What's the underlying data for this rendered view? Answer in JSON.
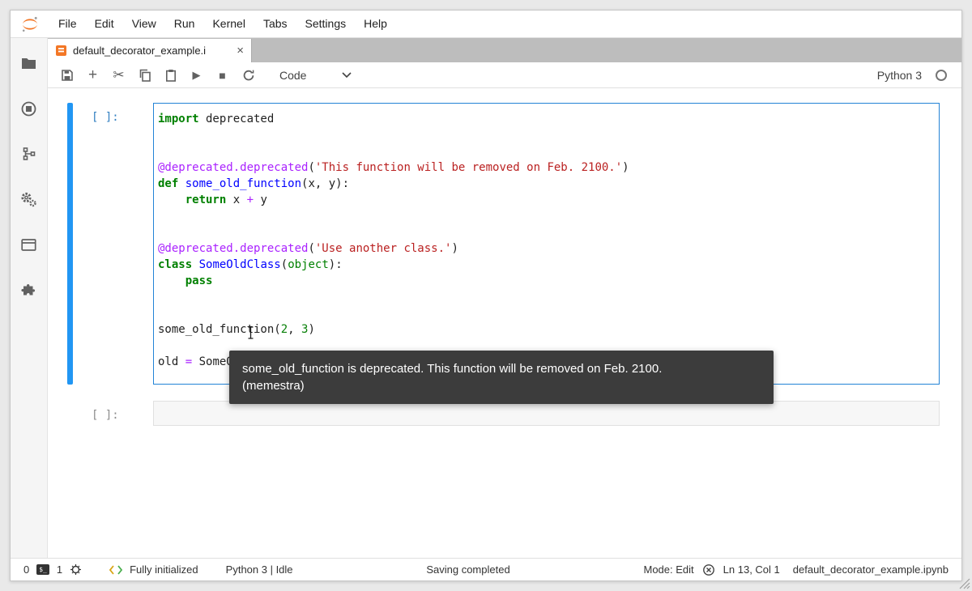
{
  "colors": {
    "accent_blue": "#2196f3",
    "cell_border_active": "#2383d6",
    "tab_strip_gray": "#bdbdbd",
    "tooltip_bg": "#3c3c3c",
    "logo_orange": "#f37726",
    "prompt_active": "#307fc1",
    "prompt_inactive": "#8c8c8c",
    "keyword_green": "#008000",
    "string_red": "#ba2121"
  },
  "menu": {
    "items": [
      "File",
      "Edit",
      "View",
      "Run",
      "Kernel",
      "Tabs",
      "Settings",
      "Help"
    ]
  },
  "tab": {
    "title": "default_decorator_example.i",
    "close_glyph": "×"
  },
  "toolbar": {
    "cell_type": "Code",
    "kernel_name": "Python 3",
    "icons": {
      "add": "+",
      "cut": "✂",
      "run": "▶",
      "stop": "■"
    }
  },
  "cells": [
    {
      "prompt": "[ ]:"
    },
    {
      "prompt": "[ ]:"
    }
  ],
  "code": {
    "lines": [
      [
        {
          "t": "import",
          "c": "kw"
        },
        {
          "t": " deprecated",
          "c": "pl"
        }
      ],
      [],
      [],
      [
        {
          "t": "@deprecated.deprecated",
          "c": "meta"
        },
        {
          "t": "(",
          "c": "pl"
        },
        {
          "t": "'This function will be removed on Feb. 2100.'",
          "c": "str"
        },
        {
          "t": ")",
          "c": "pl"
        }
      ],
      [
        {
          "t": "def",
          "c": "kw"
        },
        {
          "t": " ",
          "c": "pl"
        },
        {
          "t": "some_old_function",
          "c": "def"
        },
        {
          "t": "(x, y):",
          "c": "pl"
        }
      ],
      [
        {
          "t": "    ",
          "c": "pl"
        },
        {
          "t": "return",
          "c": "kw"
        },
        {
          "t": " x ",
          "c": "pl"
        },
        {
          "t": "+",
          "c": "op"
        },
        {
          "t": " y",
          "c": "pl"
        }
      ],
      [],
      [],
      [
        {
          "t": "@deprecated.deprecated",
          "c": "meta"
        },
        {
          "t": "(",
          "c": "pl"
        },
        {
          "t": "'Use another class.'",
          "c": "str"
        },
        {
          "t": ")",
          "c": "pl"
        }
      ],
      [
        {
          "t": "class",
          "c": "kw"
        },
        {
          "t": " ",
          "c": "pl"
        },
        {
          "t": "SomeOldClass",
          "c": "def"
        },
        {
          "t": "(",
          "c": "pl"
        },
        {
          "t": "object",
          "c": "builtin"
        },
        {
          "t": "):",
          "c": "pl"
        }
      ],
      [
        {
          "t": "    ",
          "c": "pl"
        },
        {
          "t": "pass",
          "c": "kw"
        }
      ],
      [],
      [],
      [
        {
          "t": "some_old_function(",
          "c": "pl"
        },
        {
          "t": "2",
          "c": "num"
        },
        {
          "t": ", ",
          "c": "pl"
        },
        {
          "t": "3",
          "c": "num"
        },
        {
          "t": ")",
          "c": "pl"
        }
      ],
      [],
      [
        {
          "t": "old ",
          "c": "pl"
        },
        {
          "t": "=",
          "c": "op"
        },
        {
          "t": " SomeOldClass()",
          "c": "pl"
        }
      ]
    ]
  },
  "tooltip": {
    "line1": "some_old_function is deprecated. This function will be removed on Feb. 2100.",
    "line2": "(memestra)"
  },
  "statusbar": {
    "terminals": "0",
    "terminal_glyph": "$_",
    "kernels": "1",
    "lsp_status": "Fully initialized",
    "kernel_state": "Python 3 | Idle",
    "notification": "Saving completed",
    "mode": "Mode: Edit",
    "cursor_position": "Ln 13, Col 1",
    "filename": "default_decorator_example.ipynb"
  }
}
